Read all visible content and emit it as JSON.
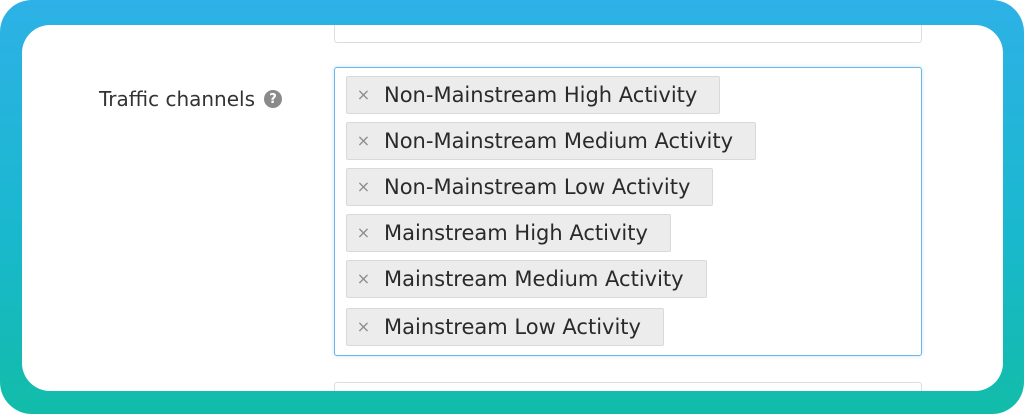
{
  "form": {
    "field_label": "Traffic channels",
    "help_icon": "question-circle-icon",
    "remove_glyph": "×",
    "selected_channels": [
      "Non-Mainstream High Activity",
      "Non-Mainstream Medium Activity",
      "Non-Mainstream Low Activity",
      "Mainstream High Activity",
      "Mainstream Medium Activity",
      "Mainstream Low Activity"
    ]
  },
  "colors": {
    "frame_gradient_top": "#2db1e6",
    "frame_gradient_bottom": "#12bca8",
    "tag_background": "#ececec",
    "focus_border": "#6cb3e6"
  }
}
